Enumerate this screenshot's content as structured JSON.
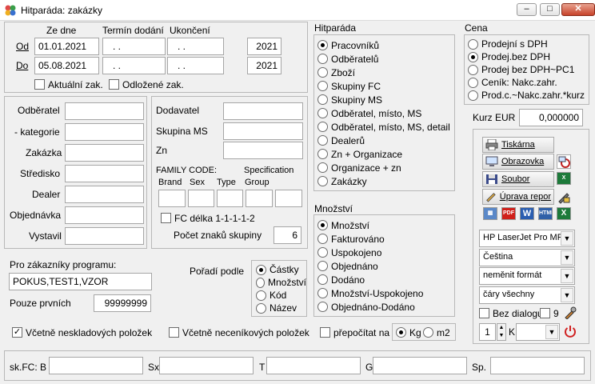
{
  "window": {
    "title": "Hitparáda: zakázky",
    "minimize": "–",
    "maximize": "□",
    "close": "✕"
  },
  "dates": {
    "col_from": "Ze dne",
    "col_delivery": "Termín dodání",
    "col_end": "Ukončení",
    "row_from": "Od",
    "row_to": "Do",
    "from_date": "01.01.2021",
    "to_date": "05.08.2021",
    "from_delivery": ". .",
    "to_delivery": ". .",
    "from_end": ". .",
    "to_end": ". .",
    "from_year": "2021",
    "to_year": "2021",
    "current_label": "Aktuální zak.",
    "deferred_label": "Odložené zak."
  },
  "filters": {
    "odberatel": "Odběratel",
    "kategorie": "- kategorie",
    "zakazka": "Zakázka",
    "stredisko": "Středisko",
    "dealer": "Dealer",
    "objednavka": "Objednávka",
    "vystavil": "Vystavil"
  },
  "supplier": {
    "dodavatel": "Dodavatel",
    "skupina_ms": "Skupina MS",
    "zn": "Zn",
    "family_code": "FAMILY CODE:",
    "specification": "Specification",
    "brand": "Brand",
    "sex": "Sex",
    "type": "Type",
    "group": "Group",
    "fc_length": "FC délka 1-1-1-1-2",
    "group_chars": "Počet znaků skupiny",
    "group_chars_value": "6"
  },
  "program": {
    "label": "Pro zákazníky programu:",
    "value": "POKUS,TEST1,VZOR",
    "first_label": "Pouze prvních",
    "first_value": "99999999"
  },
  "order_by": {
    "label": "Pořadí podle",
    "options": [
      "Částky",
      "Množství",
      "Kód",
      "Název"
    ],
    "selected": 0
  },
  "hitparada": {
    "title": "Hitparáda",
    "options": [
      "Pracovníků",
      "Odběratelů",
      "Zboží",
      "Skupiny FC",
      "Skupiny MS",
      "Odběratel, místo, MS",
      "Odběratel, místo, MS, detail",
      "Dealerů",
      "Zn + Organizace",
      "Organizace + zn",
      "Zakázky"
    ],
    "selected": 0
  },
  "mnozstvi": {
    "title": "Množství",
    "options": [
      "Množství",
      "Fakturováno",
      "Uspokojeno",
      "Objednáno",
      "Dodáno",
      "Množství-Uspokojeno",
      "Objednáno-Dodáno"
    ],
    "selected": 0
  },
  "cena": {
    "title": "Cena",
    "options": [
      "Prodejní s DPH",
      "Prodej.bez DPH",
      "Prodej bez DPH~PC1",
      "Ceník: Nakc.zahr.",
      "Prod.c.~Nakc.zahr.*kurz"
    ],
    "selected": 1
  },
  "kurz": {
    "label": "Kurz EUR",
    "value": "0,000000"
  },
  "output": {
    "tiskarna": "Tiskárna",
    "obrazovka": "Obrazovka",
    "soubor": "Soubor",
    "uprava": "Úprava repor",
    "printer": "HP LaserJet Pro MFP",
    "language": "Čeština",
    "format": "neměnit formát",
    "lines": "čáry všechny",
    "no_dialog": "Bez dialogu",
    "nine": "9",
    "copies": "1",
    "k_label": "K"
  },
  "bottom": {
    "incl_nonstock": "Včetně neskladových položek",
    "incl_unpriced": "Včetně neceníkových položek",
    "recalc": "přepočítat na",
    "kg": "Kg",
    "m2": "m2"
  },
  "fc": {
    "sk": "sk.FC: B",
    "sx": "Sx.",
    "t": "T",
    "g": "G",
    "sp": "Sp."
  },
  "colors": {
    "accent": "#0050c8",
    "close": "#c7432a",
    "excel": "#1d7a3a",
    "pdf": "#d0201a",
    "word": "#2a5db0"
  }
}
